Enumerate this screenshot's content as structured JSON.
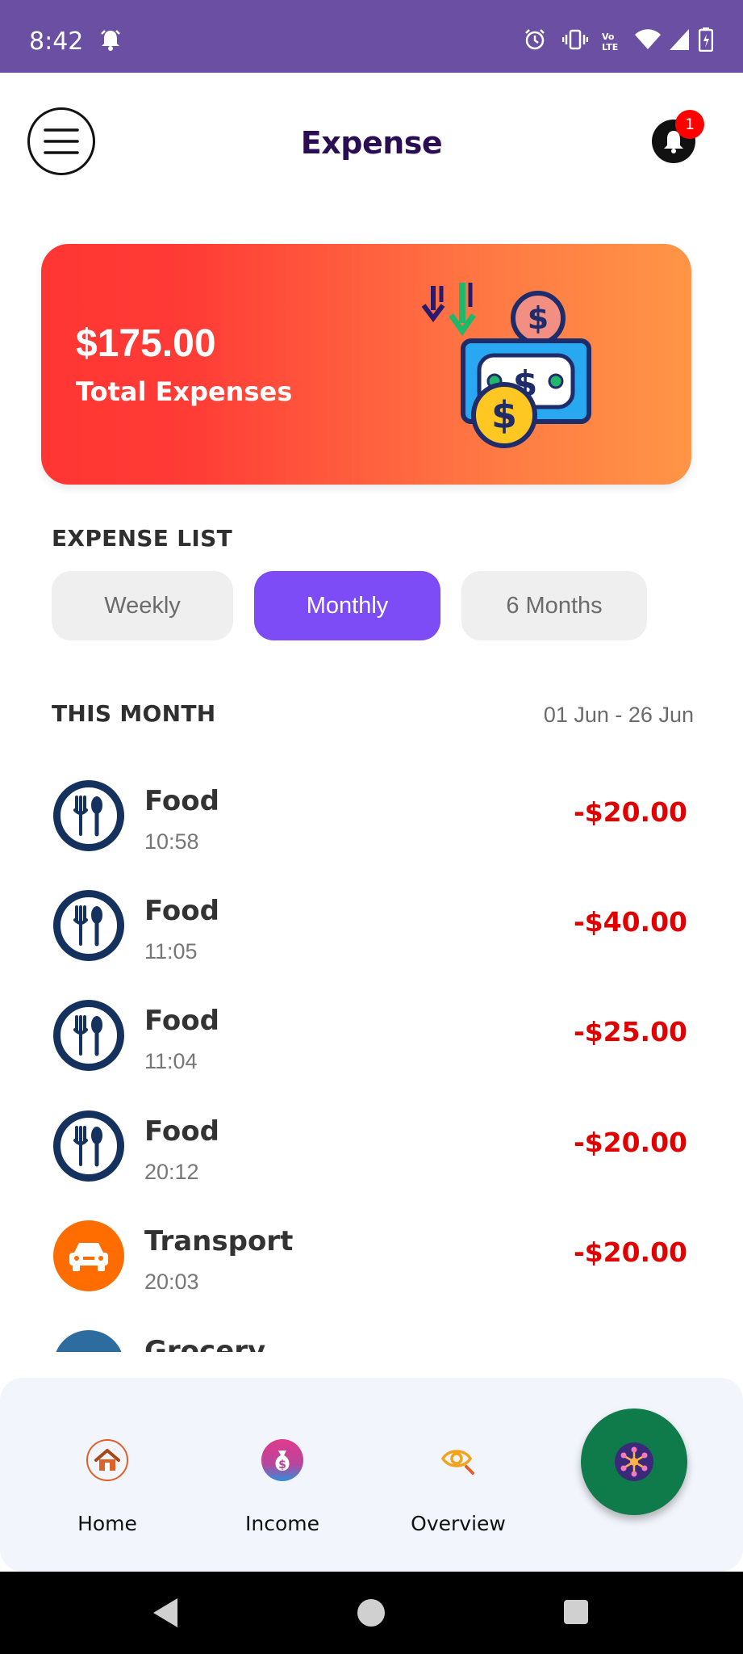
{
  "status_bar": {
    "time": "8:42",
    "icons": [
      "alarm-bell-icon",
      "alarm-clock-icon",
      "vibrate-icon",
      "volte-icon",
      "wifi-icon",
      "signal-icon",
      "battery-icon"
    ]
  },
  "header": {
    "title": "Expense",
    "notification_count": "1",
    "icons": [
      "menu-icon",
      "bell-icon"
    ]
  },
  "summary_card": {
    "total_amount": "$175.00",
    "total_label": "Total Expenses",
    "gradient": [
      "#ff3633",
      "#ff9546"
    ]
  },
  "expense_list": {
    "section_title": "EXPENSE LIST",
    "tabs": [
      {
        "label": "Weekly",
        "active": false
      },
      {
        "label": "Monthly",
        "active": true
      },
      {
        "label": "6 Months",
        "active": false
      }
    ],
    "period_title": "THIS MONTH",
    "date_range": "01 Jun - 26 Jun",
    "items": [
      {
        "category": "Food",
        "time": "10:58",
        "amount": "-$20.00",
        "icon": "food-utensils-icon"
      },
      {
        "category": "Food",
        "time": "11:05",
        "amount": "-$40.00",
        "icon": "food-utensils-icon"
      },
      {
        "category": "Food",
        "time": "11:04",
        "amount": "-$25.00",
        "icon": "food-utensils-icon"
      },
      {
        "category": "Food",
        "time": "20:12",
        "amount": "-$20.00",
        "icon": "food-utensils-icon"
      },
      {
        "category": "Transport",
        "time": "20:03",
        "amount": "-$20.00",
        "icon": "car-icon"
      },
      {
        "category": "Grocery",
        "time": "",
        "amount": "",
        "icon": "grocery-icon"
      }
    ]
  },
  "bottom_nav": {
    "items": [
      {
        "label": "Home",
        "icon": "home-icon"
      },
      {
        "label": "Income",
        "icon": "money-bag-icon"
      },
      {
        "label": "Overview",
        "icon": "eye-search-icon"
      }
    ],
    "fab_icon": "network-hub-icon"
  },
  "colors": {
    "status_bar": "#6a4fa3",
    "title": "#2a0d52",
    "active_tab": "#7d4cf6",
    "amount": "#e00000",
    "fab": "#0f7a4a"
  }
}
